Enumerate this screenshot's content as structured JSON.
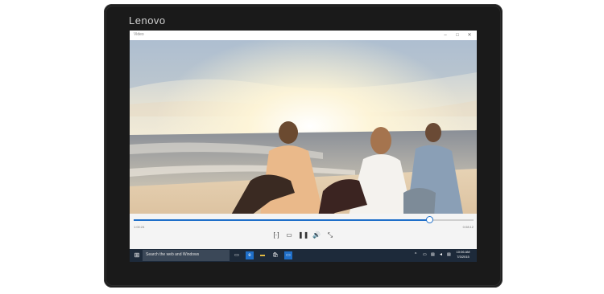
{
  "device": {
    "brand": "Lenovo"
  },
  "window": {
    "title": "Video",
    "minimize_icon": "minimize-icon",
    "maximize_icon": "maximize-icon",
    "close_icon": "close-icon",
    "minimize_glyph": "–",
    "maximize_glyph": "□",
    "close_glyph": "✕"
  },
  "player": {
    "elapsed": "1:00:24",
    "remaining": "0:08:12",
    "progress": 0.87,
    "controls": [
      {
        "name": "captions-icon",
        "glyph": "[·]"
      },
      {
        "name": "aspect-ratio-icon",
        "glyph": "▭"
      },
      {
        "name": "pause-icon",
        "glyph": "❚❚"
      },
      {
        "name": "volume-icon",
        "glyph": "🔊"
      },
      {
        "name": "exit-fullscreen-icon",
        "glyph": "⤡"
      }
    ]
  },
  "taskbar": {
    "search_placeholder": "Search the web and Windows",
    "time": "10:06 AM",
    "date": "7/3/2015",
    "accent": "#1f6fc9"
  }
}
